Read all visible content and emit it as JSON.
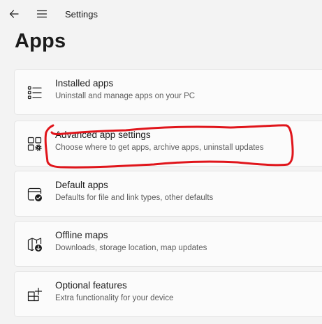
{
  "window": {
    "app_title": "Settings",
    "page_title": "Apps"
  },
  "titlebar": {
    "back_icon": "arrow-left-icon",
    "menu_icon": "hamburger-menu-icon"
  },
  "cards": [
    {
      "title": "Installed apps",
      "description": "Uninstall and manage apps on your PC",
      "icon": "list-icon"
    },
    {
      "title": "Advanced app settings",
      "description": "Choose where to get apps, archive apps, uninstall updates",
      "icon": "apps-gear-icon"
    },
    {
      "title": "Default apps",
      "description": "Defaults for file and link types, other defaults",
      "icon": "window-check-icon"
    },
    {
      "title": "Offline maps",
      "description": "Downloads, storage location, map updates",
      "icon": "map-download-icon"
    },
    {
      "title": "Optional features",
      "description": "Extra functionality for your device",
      "icon": "grid-plus-icon"
    }
  ],
  "annotation": {
    "color": "#e0151b",
    "target": "Advanced app settings"
  }
}
